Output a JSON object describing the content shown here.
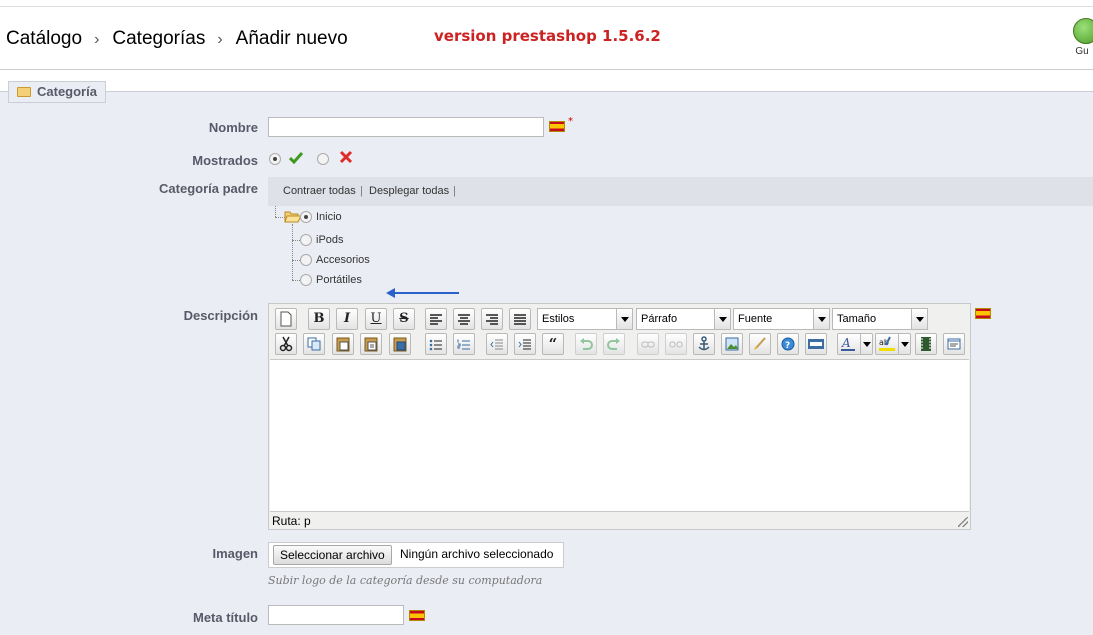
{
  "breadcrumb": {
    "items": [
      "Catálogo",
      "Categorías",
      "Añadir nuevo"
    ],
    "separator": "›"
  },
  "annotation": "version prestashop 1.5.6.2",
  "save_button": {
    "label": "Gu"
  },
  "fieldset": {
    "legend": "Categoría"
  },
  "fields": {
    "name": {
      "label": "Nombre",
      "value": "",
      "required_mark": "*"
    },
    "displayed": {
      "label": "Mostrados",
      "selected": "yes"
    },
    "parent": {
      "label": "Categoría padre",
      "collapse_all": "Contraer todas",
      "expand_all": "Desplegar todas",
      "sep": "|",
      "tree": [
        {
          "label": "Inicio",
          "selected": true
        },
        {
          "label": "iPods",
          "selected": false
        },
        {
          "label": "Accesorios",
          "selected": false
        },
        {
          "label": "Portátiles",
          "selected": false
        }
      ]
    },
    "description": {
      "label": "Descripción",
      "selects": [
        "Estilos",
        "Párrafo",
        "Fuente",
        "Tamaño"
      ],
      "path_label": "Ruta: p"
    },
    "image": {
      "label": "Imagen",
      "button": "Seleccionar archivo",
      "status": "Ningún archivo seleccionado",
      "hint": "Subir logo de la categoría desde su computadora"
    },
    "meta_title": {
      "label": "Meta título",
      "value": ""
    }
  },
  "colors": {
    "annotation": "#cc2222",
    "panel_bg": "#ebedf4",
    "label": "#585a69",
    "arrow": "#2a62c9"
  }
}
